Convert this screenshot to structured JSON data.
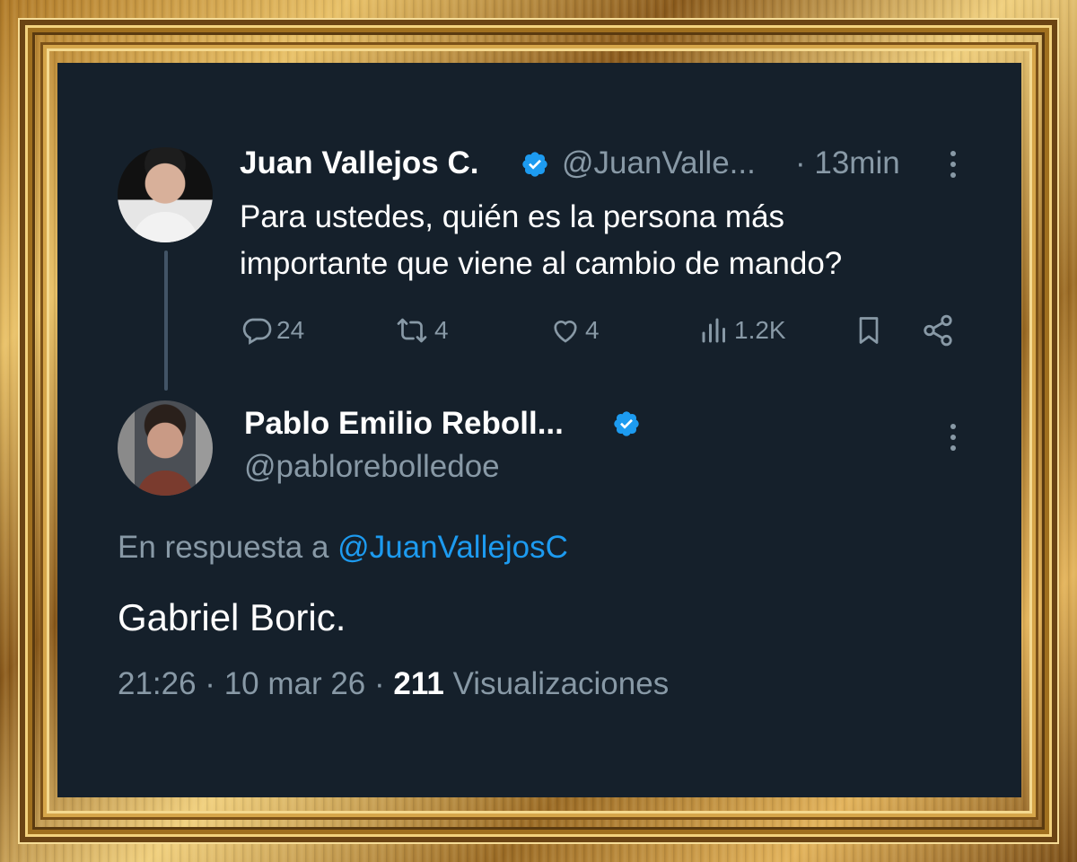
{
  "tweet": {
    "author_name": "Juan Vallejos C.",
    "handle": "@JuanValle...",
    "time": "· 13min",
    "text_line1": "Para ustedes, quién es la persona más",
    "text_line2": "importante que viene al cambio de mando?",
    "replies": "24",
    "retweets": "4",
    "likes": "4",
    "views": "1.2K"
  },
  "reply": {
    "author_name": "Pablo Emilio Reboll...",
    "handle": "@pablorebolledoe",
    "reply_prefix": "En respuesta a",
    "reply_mention": "@JuanVallejosC",
    "text": "Gabriel Boric.",
    "timestamp": "21:26 · 10 mar 26 ·",
    "views_count": "211",
    "views_label": "Visualizaciones"
  },
  "colors": {
    "background": "#15202b",
    "accent": "#1d9bf0",
    "muted": "#8899a6",
    "text": "#ffffff"
  }
}
